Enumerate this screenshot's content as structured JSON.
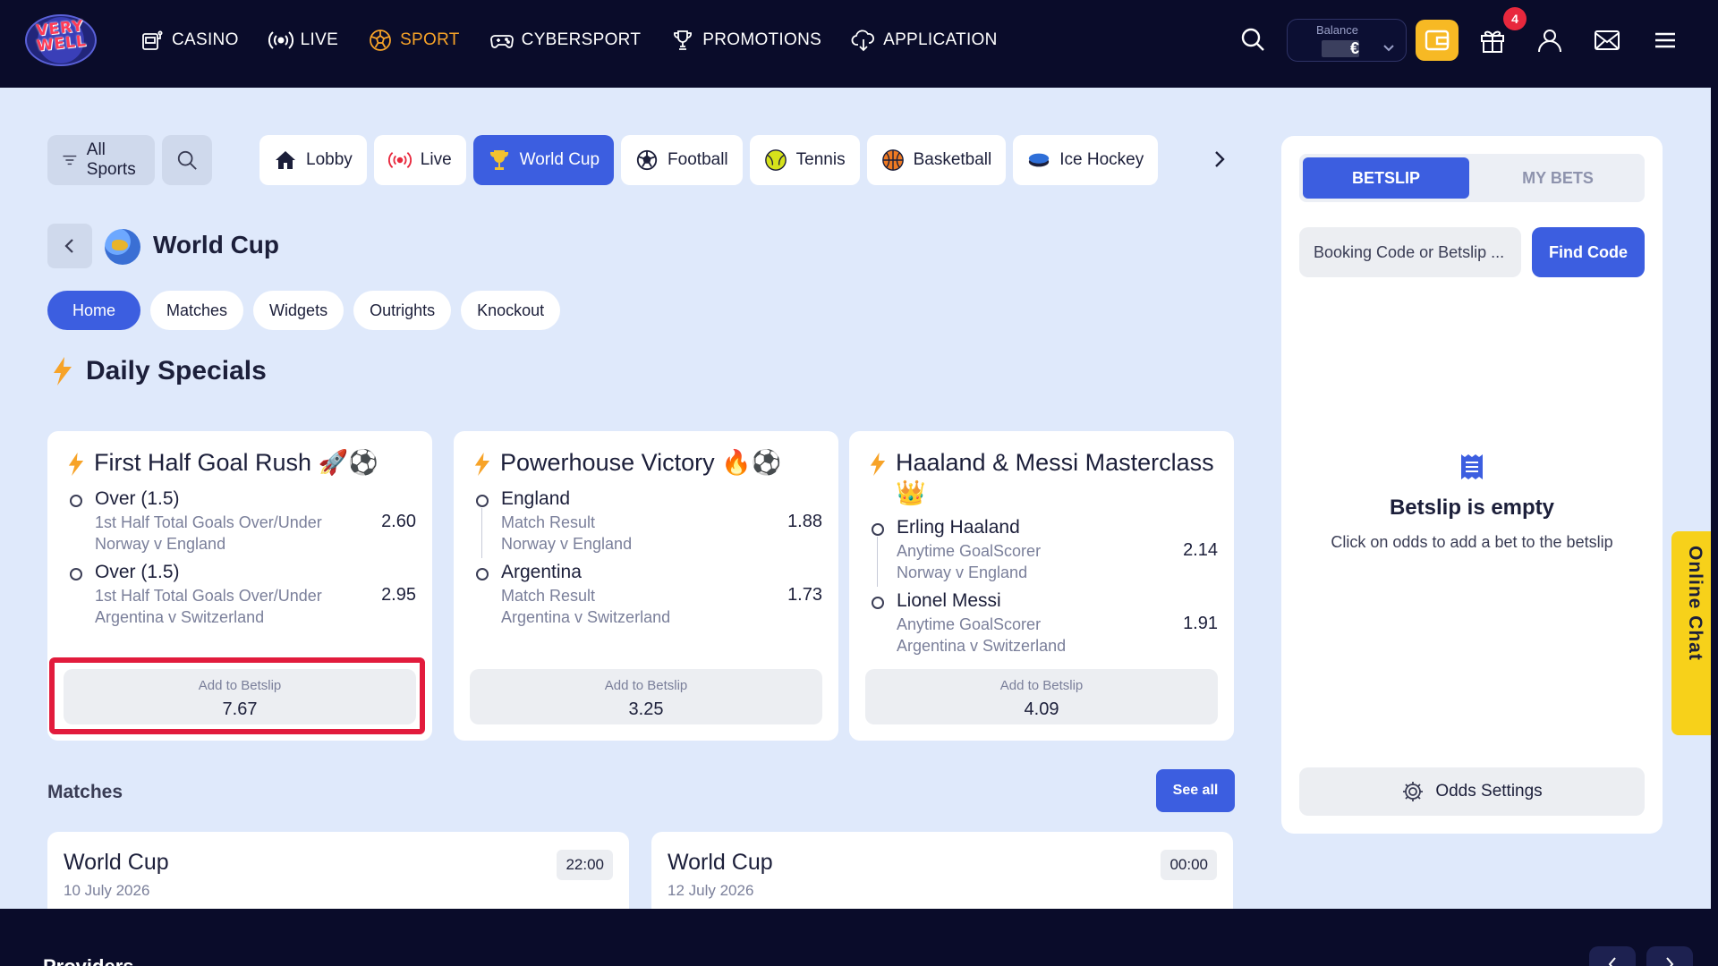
{
  "nav": {
    "logo_text": "VERY WELL",
    "items": [
      {
        "label": "CASINO",
        "icon": "slot-machine-icon"
      },
      {
        "label": "LIVE",
        "icon": "broadcast-icon"
      },
      {
        "label": "SPORT",
        "icon": "soccer-ball-icon",
        "active": true
      },
      {
        "label": "CYBERSPORT",
        "icon": "gamepad-icon"
      },
      {
        "label": "PROMOTIONS",
        "icon": "trophy-icon"
      },
      {
        "label": "APPLICATION",
        "icon": "cloud-download-icon"
      }
    ],
    "balance_label": "Balance",
    "currency": "€",
    "gift_badge": "4"
  },
  "sports_bar": {
    "all_sports": "All Sports",
    "items": [
      {
        "label": "Lobby",
        "icon": "home-icon"
      },
      {
        "label": "Live",
        "icon": "live-broadcast-icon"
      },
      {
        "label": "World Cup",
        "icon": "trophy-icon",
        "active": true
      },
      {
        "label": "Football",
        "icon": "football-icon"
      },
      {
        "label": "Tennis",
        "icon": "tennis-ball-icon"
      },
      {
        "label": "Basketball",
        "icon": "basketball-icon"
      },
      {
        "label": "Ice Hockey",
        "icon": "hockey-puck-icon"
      }
    ]
  },
  "page": {
    "title": "World Cup",
    "subtabs": [
      "Home",
      "Matches",
      "Widgets",
      "Outrights",
      "Knockout"
    ],
    "daily_specials": "Daily Specials"
  },
  "specials": [
    {
      "title": "First Half Goal Rush 🚀⚽",
      "legs": [
        {
          "selection": "Over (1.5)",
          "market": "1st Half Total Goals Over/Under",
          "event": "Norway v England",
          "odds": "2.60"
        },
        {
          "selection": "Over (1.5)",
          "market": "1st Half Total Goals Over/Under",
          "event": "Argentina v Switzerland",
          "odds": "2.95"
        }
      ],
      "add_label": "Add to Betslip",
      "total": "7.67"
    },
    {
      "title": "Powerhouse Victory 🔥⚽",
      "legs": [
        {
          "selection": "England",
          "market": "Match Result",
          "event": "Norway v England",
          "odds": "1.88"
        },
        {
          "selection": "Argentina",
          "market": "Match Result",
          "event": "Argentina v Switzerland",
          "odds": "1.73"
        }
      ],
      "add_label": "Add to Betslip",
      "total": "3.25"
    },
    {
      "title": "Haaland & Messi Masterclass 👑",
      "legs": [
        {
          "selection": "Erling Haaland",
          "market": "Anytime GoalScorer",
          "event": "Norway v England",
          "odds": "2.14"
        },
        {
          "selection": "Lionel Messi",
          "market": "Anytime GoalScorer",
          "event": "Argentina v Switzerland",
          "odds": "1.91"
        }
      ],
      "add_label": "Add to Betslip",
      "total": "4.09"
    }
  ],
  "matches": {
    "heading": "Matches",
    "see_all": "See all",
    "cards": [
      {
        "title": "World Cup",
        "date": "10 July 2026",
        "time": "22:00"
      },
      {
        "title": "World Cup",
        "date": "12 July 2026",
        "time": "00:00"
      }
    ]
  },
  "betslip": {
    "tab_betslip": "BETSLIP",
    "tab_mybets": "MY BETS",
    "code_placeholder": "Booking Code or Betslip ...",
    "find_code": "Find Code",
    "empty_title": "Betslip is empty",
    "empty_sub": "Click on odds to add a bet to the betslip",
    "odds_settings": "Odds Settings"
  },
  "online_chat": "Online Chat",
  "footer": {
    "providers": "Providers"
  },
  "colors": {
    "accent": "#3c5ee0",
    "nav_bg": "#0a0c2a",
    "sport_active": "#f7a328",
    "highlight": "#e21b3c",
    "chat": "#f7d11a"
  }
}
